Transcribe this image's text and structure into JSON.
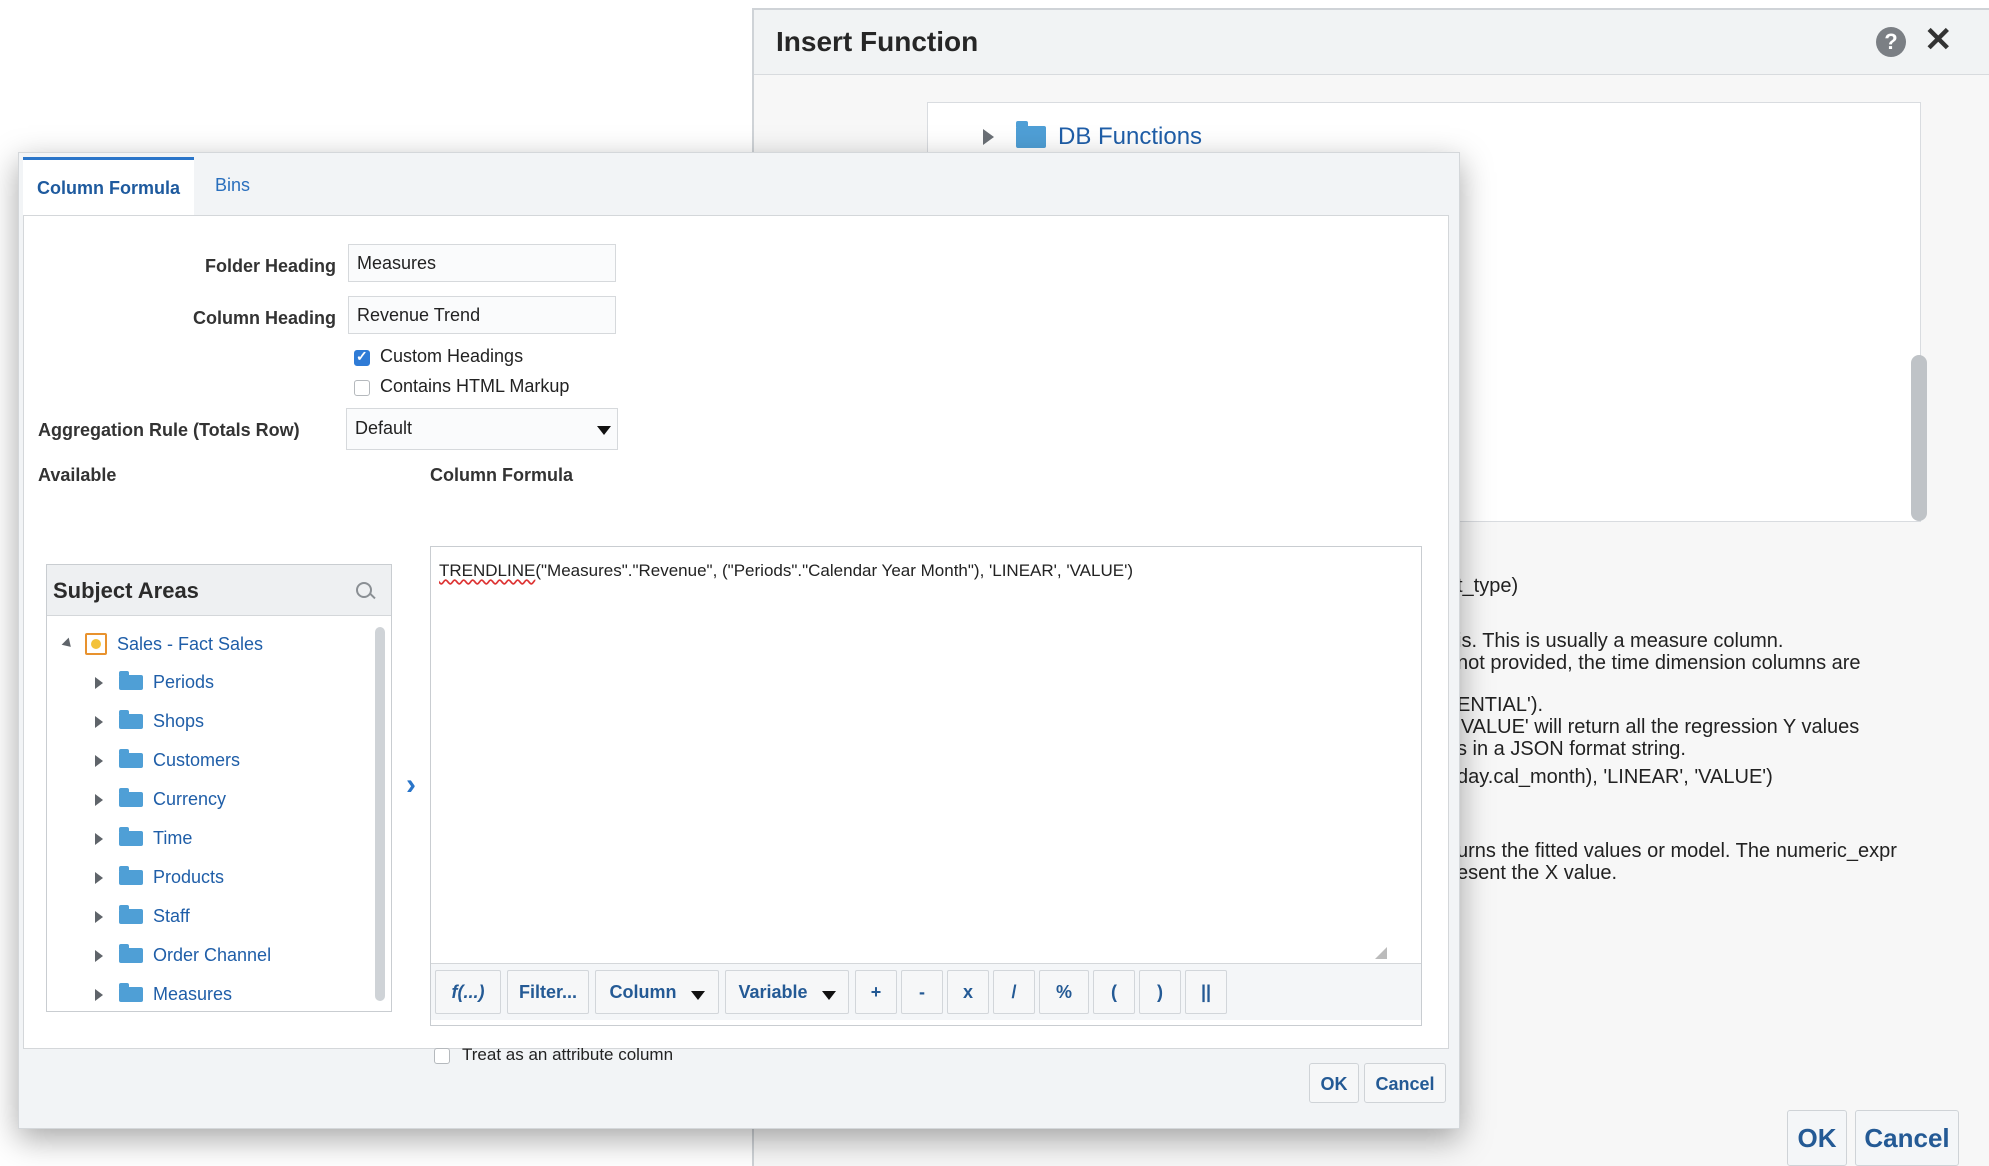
{
  "insert_function": {
    "title": "Insert Function",
    "help_glyph": "?",
    "close_glyph": "✕",
    "tree": {
      "folder_label": "DB Functions"
    },
    "description_lines": [
      "t_type)",
      "is. This is usually a measure column.",
      "not provided, the time dimension columns are",
      "ENTIAL').",
      "'VALUE' will return all the regression Y values",
      "s in a JSON format string.",
      "day.cal_month), 'LINEAR', 'VALUE')",
      "urns the fitted values or model. The numeric_expr",
      "esent the X value."
    ],
    "ok_label": "OK",
    "cancel_label": "Cancel"
  },
  "column_properties": {
    "tabs": [
      {
        "label": "Column Formula",
        "active": true
      },
      {
        "label": "Bins",
        "active": false
      }
    ],
    "folder_heading": {
      "label": "Folder Heading",
      "value": "Measures"
    },
    "column_heading": {
      "label": "Column Heading",
      "value": "Revenue Trend"
    },
    "custom_headings": {
      "label": "Custom Headings",
      "checked": true
    },
    "contains_html": {
      "label": "Contains HTML Markup",
      "checked": false
    },
    "aggregation": {
      "label": "Aggregation Rule (Totals Row)",
      "value": "Default"
    },
    "available_label": "Available",
    "subject_areas": {
      "title": "Subject Areas",
      "root": "Sales - Fact Sales",
      "folders": [
        "Periods",
        "Shops",
        "Customers",
        "Currency",
        "Time",
        "Products",
        "Staff",
        "Order Channel",
        "Measures"
      ]
    },
    "formula": {
      "label": "Column Formula",
      "fn_name": "TRENDLINE",
      "fn_args": "(\"Measures\".\"Revenue\", (\"Periods\".\"Calendar Year Month\"), 'LINEAR', 'VALUE')",
      "toolbar": {
        "fn": "f(...)",
        "filter": "Filter...",
        "column": "Column",
        "variable": "Variable",
        "plus": "+",
        "minus": "-",
        "times": "x",
        "divide": "/",
        "percent": "%",
        "lparen": "(",
        "rparen": ")",
        "concat": "||"
      }
    },
    "attribute_column": {
      "label": "Treat as an attribute column",
      "checked": false
    },
    "ok_label": "OK",
    "cancel_label": "Cancel"
  },
  "colors": {
    "accent": "#2a75c9",
    "link": "#1f5ea8",
    "folder": "#4f9fd6"
  }
}
